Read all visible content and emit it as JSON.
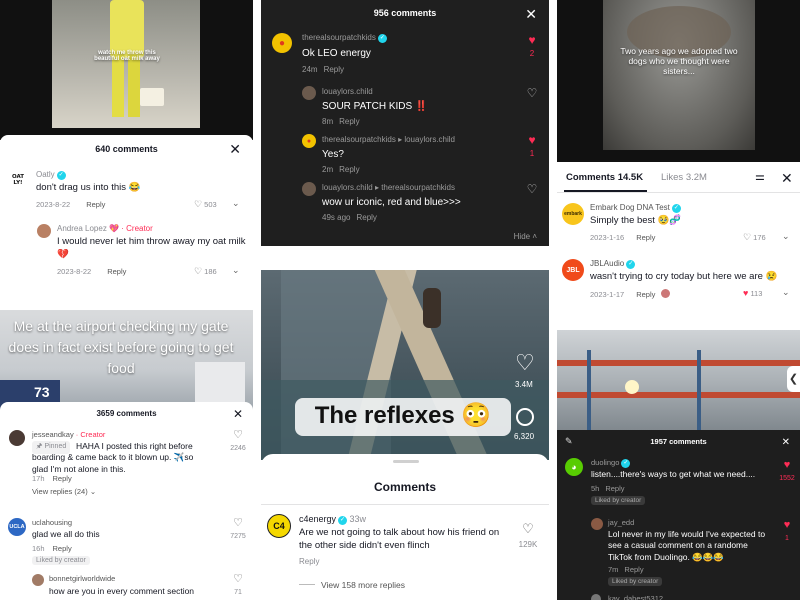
{
  "p1": {
    "video_caption": "watch me throw this beautiful oat milk away",
    "header": "640 comments",
    "comments": [
      {
        "avatar": "OAT LY!",
        "user": "Oatly",
        "verified": true,
        "text": "don't drag us into this 😂",
        "date": "2023-8-22",
        "reply": "Reply",
        "likes": "503"
      },
      {
        "user": "Andrea Lopez 💖",
        "badge": "· Creator",
        "text": "I would never let him throw away my oat milk 💔",
        "date": "2023-8-22",
        "reply": "Reply",
        "likes": "186"
      }
    ]
  },
  "p2": {
    "header": "956 comments",
    "comments": [
      {
        "user": "therealsourpatchkids",
        "verified": true,
        "text": "Ok LEO energy",
        "time": "24m",
        "reply": "Reply",
        "likes": "2",
        "liked": true
      },
      {
        "user": "louaylors.child",
        "text": "SOUR PATCH KIDS ‼️",
        "time": "8m",
        "reply": "Reply",
        "likes": "",
        "liked": false
      },
      {
        "user": "therealsourpatchkids",
        "reply_to": "louaylors.child",
        "text": "Yes?",
        "time": "2m",
        "reply": "Reply",
        "likes": "1",
        "liked": true
      },
      {
        "user": "louaylors.child",
        "reply_to": "therealsourpatchkids",
        "text": "wow ur iconic, red and blue>>>",
        "time": "49s ago",
        "reply": "Reply",
        "likes": "",
        "liked": false
      }
    ],
    "hide": "Hide"
  },
  "p3": {
    "video_caption": "Two years ago we adopted two dogs who we thought were sisters...",
    "tabs": [
      "Comments 14.5K",
      "Likes 3.2M"
    ],
    "comments": [
      {
        "avatar": "embark",
        "user": "Embark Dog DNA Test",
        "verified": true,
        "text": "Simply the best 🥹🧬",
        "date": "2023-1-16",
        "reply": "Reply",
        "likes": "176"
      },
      {
        "avatar": "JBL",
        "user": "JBLAudio",
        "verified": true,
        "text": "wasn't trying to cry today but here we are 😢",
        "date": "2023-1-17",
        "reply": "Reply",
        "likes": "113"
      }
    ]
  },
  "p4": {
    "video_caption": "Me at the airport checking my gate does in fact exist before going to get food",
    "gate_number": "73",
    "header": "3659 comments",
    "comments": [
      {
        "user": "jesseandkay",
        "badge": "· Creator",
        "pinned": "Pinned",
        "text": "HAHA I posted this right before boarding & came back to it blown up. ✈️so glad I'm not alone in this.",
        "time": "17h",
        "reply": "Reply",
        "likes": "2246",
        "view_replies": "View replies (24)"
      },
      {
        "avatar": "UCLA",
        "user": "uclahousing",
        "text": "glad we all do this",
        "time": "16h",
        "reply": "Reply",
        "likes": "7275",
        "liked_by": "Liked by creator"
      },
      {
        "user": "bonnetgirlworldwide",
        "text": "how are you in every comment section",
        "likes": "71"
      }
    ]
  },
  "p5": {
    "video_caption": "The reflexes 😳",
    "side_likes": "3.4M",
    "side_comments": "6,320",
    "header": "Comments",
    "comment": {
      "avatar": "C4",
      "user": "c4energy",
      "verified": true,
      "age": "33w",
      "text": "Are we not going to talk about how his friend on the other side didn't even flinch",
      "reply": "Reply",
      "likes": "129K"
    },
    "more_replies": "View 158 more replies"
  },
  "p6": {
    "header": "1957 comments",
    "comments": [
      {
        "user": "duolingo",
        "verified": true,
        "text": "listen....there's ways to get what we need....",
        "time": "5h",
        "reply": "Reply",
        "likes": "1552",
        "liked_by": "Liked by creator"
      },
      {
        "user": "jay_edd",
        "text": "Lol never in my life would I've expected to see a casual comment on a randome TikTok from Duolingo. 😂😂😂",
        "time": "7m",
        "reply": "Reply",
        "likes": "1",
        "liked_by": "Liked by creator"
      },
      {
        "user": "kay_dabest5312"
      }
    ]
  },
  "colors": {
    "tiktok_red": "#fe2c55",
    "verified": "#20d5ec",
    "creator": "#fe2c55",
    "duolingo": "#58cc02"
  }
}
